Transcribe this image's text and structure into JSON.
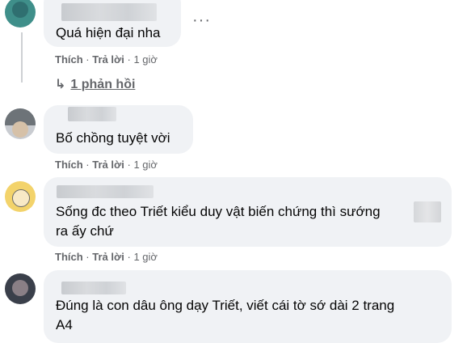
{
  "comments": [
    {
      "text": "Quá hiện đại nha",
      "like": "Thích",
      "reply": "Trả lời",
      "time": "1 giờ",
      "replies_label": "1 phản hồi"
    },
    {
      "text": "Bố chồng tuyệt vời",
      "like": "Thích",
      "reply": "Trả lời",
      "time": "1 giờ"
    },
    {
      "text_line1": "Sống đc theo Triết kiểu duy vật biến chứng thì sướng",
      "text_line2": "ra ấy chứ",
      "like": "Thích",
      "reply": "Trả lời",
      "time": "1 giờ"
    },
    {
      "text_line1": "Đúng là con dâu ông dạy Triết, viết cái tờ sớ dài 2 trang",
      "text_line2": "A4"
    }
  ],
  "separator": "·",
  "more_options": "···",
  "icons": [
    "avatar",
    "more-options-icon",
    "reply-arrow-icon"
  ]
}
